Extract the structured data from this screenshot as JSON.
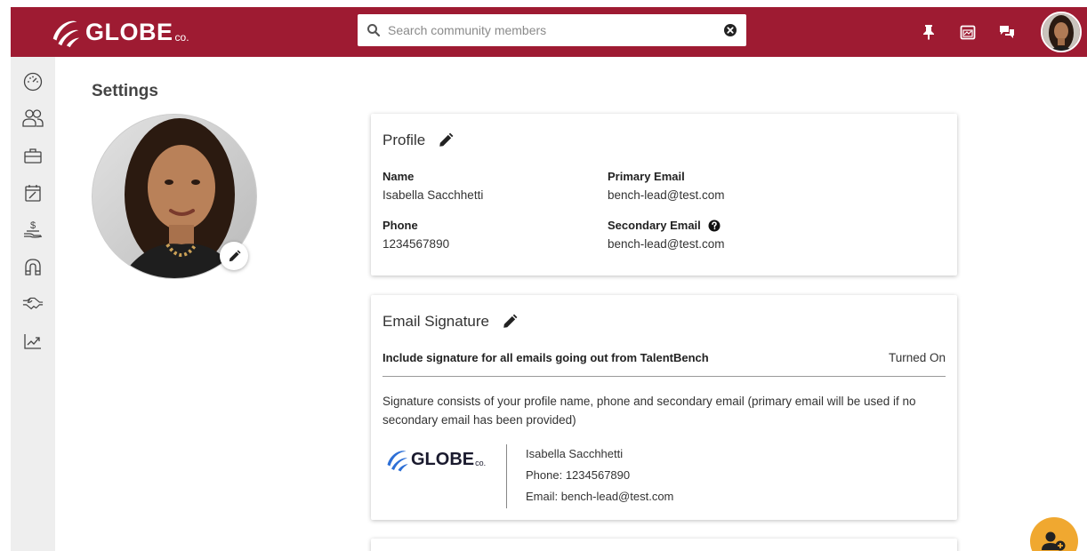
{
  "brand": {
    "name": "GLOBE",
    "suffix": "co.",
    "color": "#9e1b32",
    "accent": "#f0a830"
  },
  "search": {
    "placeholder": "Search community members",
    "value": ""
  },
  "topbar_icons": [
    "pin-icon",
    "calendar-icon",
    "chat-icon"
  ],
  "sidebar": {
    "items": [
      {
        "icon": "dashboard-icon"
      },
      {
        "icon": "people-icon"
      },
      {
        "icon": "briefcase-icon"
      },
      {
        "icon": "calendar-edit-icon"
      },
      {
        "icon": "money-hand-icon"
      },
      {
        "icon": "magnet-icon"
      },
      {
        "icon": "handshake-icon"
      },
      {
        "icon": "analytics-icon"
      }
    ]
  },
  "page": {
    "title": "Settings"
  },
  "profile": {
    "title": "Profile",
    "name_label": "Name",
    "name": "Isabella Sacchhetti",
    "phone_label": "Phone",
    "phone": "1234567890",
    "primary_email_label": "Primary Email",
    "primary_email": "bench-lead@test.com",
    "secondary_email_label": "Secondary Email",
    "secondary_email": "bench-lead@test.com"
  },
  "signature": {
    "title": "Email Signature",
    "toggle_label": "Include signature for all emails going out from TalentBench",
    "status": "Turned On",
    "description": "Signature consists of your profile name, phone and secondary email (primary email will be used if no secondary email has been provided)",
    "preview": {
      "logo_text": "GLOBE",
      "logo_suffix": "co.",
      "name": "Isabella Sacchhetti",
      "phone": "Phone: 1234567890",
      "email": "Email: bench-lead@test.com"
    }
  }
}
